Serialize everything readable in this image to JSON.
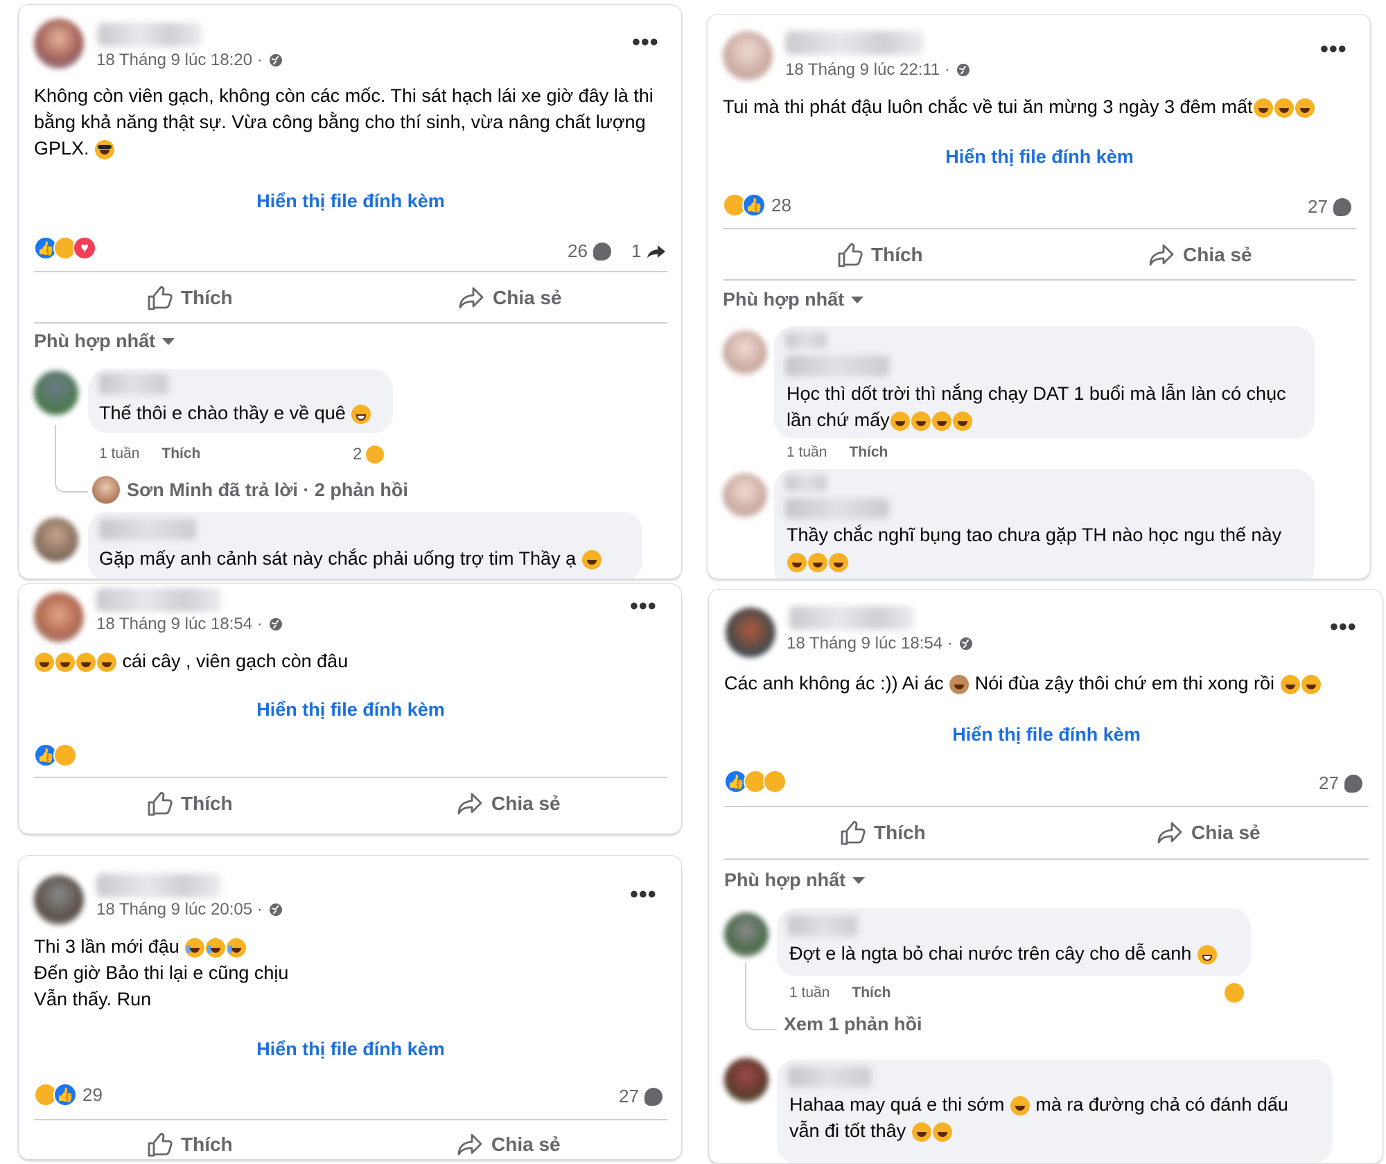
{
  "common": {
    "attach_label": "Hiển thị file đính kèm",
    "like_label": "Thích",
    "share_label": "Chia sẻ",
    "sort_label": "Phù hợp nhất",
    "comment_like": "Thích",
    "comment_age": "1 tuần"
  },
  "post1": {
    "time": "18 Tháng 9 lúc 18:20 ·",
    "text": "Không còn viên gạch, không còn các mốc. Thi sát hạch lái xe giờ đây là thi bằng khả năng thật sự. Vừa công bằng cho thí sinh, vừa nâng chất lượng GPLX.",
    "comments_count": "26",
    "shares_count": "1",
    "c1_text": "Thế thôi e chào thầy e về quê",
    "c1_reacts": "2",
    "c1_replies": "Sơn Minh đã trả lời · 2 phản hồi",
    "c2_text": "Gặp mấy anh cảnh sát này chắc phải uống trợ tim Thầy ạ"
  },
  "post2": {
    "time": "18 Tháng 9 lúc 22:11 ·",
    "text": "Tui mà thi phát đậu luôn chắc về tui ăn mừng 3 ngày 3 đêm mất",
    "reacts_count": "28",
    "comments_count": "27",
    "c1_text_a": "Học thì dốt trời thì nắng chạy DAT 1 buổi mà lẫn làn có chục",
    "c1_text_b": "lần chứ mấy",
    "c2_text": "Thầy chắc nghĩ bụng tao chưa gặp TH nào học ngu thế này"
  },
  "post3": {
    "time": "18 Tháng 9 lúc 18:54 ·",
    "text": "cái cây , viên gạch còn đâu"
  },
  "post4": {
    "time": "18 Tháng 9 lúc 18:54 ·",
    "text_a": "Các anh không ác :)) Ai ác",
    "text_b": "Nói đùa zậy thôi chứ em thi xong rồi",
    "comments_count": "27",
    "c1_text": "Đợt e là ngta bỏ chai nước trên cây cho dễ canh",
    "c1_view_replies": "Xem 1 phản hồi",
    "c2_text_a": "Hahaa may quá e thi sớm",
    "c2_text_b": "mà ra đường chả có đánh dấu",
    "c2_text_c": "vẫn đi tốt thây"
  },
  "post5": {
    "time": "18 Tháng 9 lúc 20:05 ·",
    "line1": "Thi 3 lần mới đậu",
    "line2": "Đến giờ Bảo thi lại e cũng chịu",
    "line3": "Vẫn thấy. Run",
    "reacts_count": "29",
    "comments_count": "27"
  }
}
